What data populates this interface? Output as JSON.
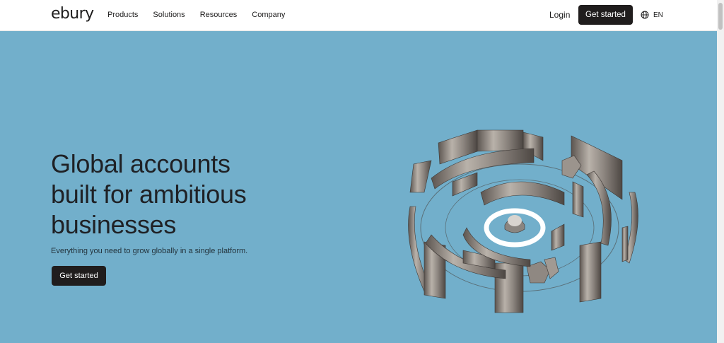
{
  "header": {
    "logo": "ebury",
    "nav": [
      "Products",
      "Solutions",
      "Resources",
      "Company"
    ],
    "login": "Login",
    "cta": "Get started",
    "language": "EN",
    "language_icon": "globe-icon"
  },
  "hero": {
    "headline_lines": [
      "Global accounts",
      "built for ambitious",
      "businesses"
    ],
    "subtitle": "Everything you need to grow globally in a single platform.",
    "cta": "Get started"
  },
  "colors": {
    "hero_bg": "#72afcb",
    "button_bg": "#201d1d",
    "text_dark": "#1f2125"
  }
}
